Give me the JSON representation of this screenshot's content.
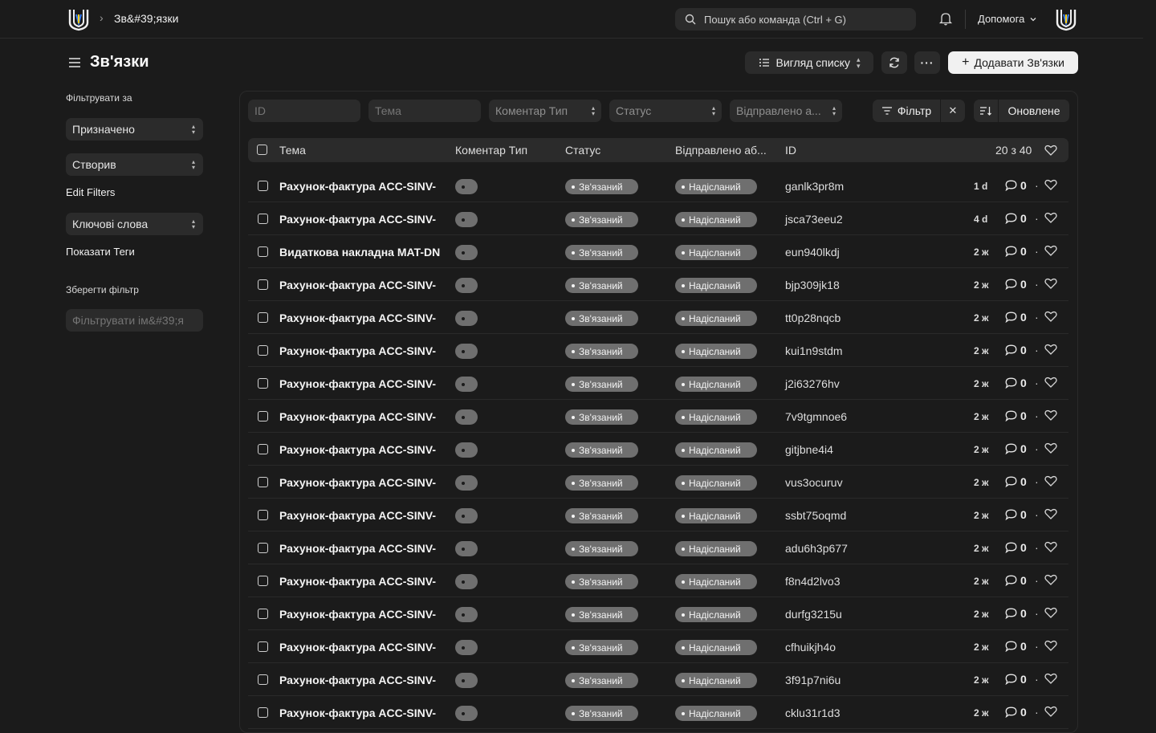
{
  "topbar": {
    "breadcrumb": "Зв&#39;язки",
    "search_placeholder": "Пошук або команда (Ctrl + G)",
    "help_label": "Допомога"
  },
  "header": {
    "title": "Зв'язки",
    "view_label": "Вигляд списку",
    "add_label": "Додавати Зв'язки"
  },
  "sidebar": {
    "filter_by_label": "Фільтрувати за",
    "assigned_label": "Призначено",
    "created_label": "Створив",
    "edit_filters_label": "Edit Filters",
    "keywords_label": "Ключові слова",
    "show_tags_label": "Показати Теги",
    "save_filter_label": "Зберегти фільтр",
    "filter_name_placeholder": "Фільтрувати ім&#39;я"
  },
  "filters": {
    "id_placeholder": "ID",
    "subject_placeholder": "Тема",
    "comment_type_label": "Коментар Тип",
    "status_label": "Статус",
    "sent_label": "Відправлено а...",
    "filter_button": "Фільтр",
    "sort_field": "Оновлене"
  },
  "table": {
    "columns": {
      "subject": "Тема",
      "comment_type": "Коментар Тип",
      "status": "Статус",
      "sent_or_received": "Відправлено аб...",
      "id": "ID"
    },
    "count_label": "20 з 40",
    "rows": [
      {
        "subject": "Рахунок-фактура ACC-SINV-",
        "status": "Зв'язаний",
        "sent": "Надісланий",
        "id": "ganlk3pr8m",
        "age": "1 d",
        "comments": "0"
      },
      {
        "subject": "Рахунок-фактура ACC-SINV-",
        "status": "Зв'язаний",
        "sent": "Надісланий",
        "id": "jsca73eeu2",
        "age": "4 d",
        "comments": "0"
      },
      {
        "subject": "Видаткова накладна MAT-DN",
        "status": "Зв'язаний",
        "sent": "Надісланий",
        "id": "eun940lkdj",
        "age": "2 ж",
        "comments": "0"
      },
      {
        "subject": "Рахунок-фактура ACC-SINV-",
        "status": "Зв'язаний",
        "sent": "Надісланий",
        "id": "bjp309jk18",
        "age": "2 ж",
        "comments": "0"
      },
      {
        "subject": "Рахунок-фактура ACC-SINV-",
        "status": "Зв'язаний",
        "sent": "Надісланий",
        "id": "tt0p28nqcb",
        "age": "2 ж",
        "comments": "0"
      },
      {
        "subject": "Рахунок-фактура ACC-SINV-",
        "status": "Зв'язаний",
        "sent": "Надісланий",
        "id": "kui1n9stdm",
        "age": "2 ж",
        "comments": "0"
      },
      {
        "subject": "Рахунок-фактура ACC-SINV-",
        "status": "Зв'язаний",
        "sent": "Надісланий",
        "id": "j2i63276hv",
        "age": "2 ж",
        "comments": "0"
      },
      {
        "subject": "Рахунок-фактура ACC-SINV-",
        "status": "Зв'язаний",
        "sent": "Надісланий",
        "id": "7v9tgmnoe6",
        "age": "2 ж",
        "comments": "0"
      },
      {
        "subject": "Рахунок-фактура ACC-SINV-",
        "status": "Зв'язаний",
        "sent": "Надісланий",
        "id": "gitjbne4i4",
        "age": "2 ж",
        "comments": "0"
      },
      {
        "subject": "Рахунок-фактура ACC-SINV-",
        "status": "Зв'язаний",
        "sent": "Надісланий",
        "id": "vus3ocuruv",
        "age": "2 ж",
        "comments": "0"
      },
      {
        "subject": "Рахунок-фактура ACC-SINV-",
        "status": "Зв'язаний",
        "sent": "Надісланий",
        "id": "ssbt75oqmd",
        "age": "2 ж",
        "comments": "0"
      },
      {
        "subject": "Рахунок-фактура ACC-SINV-",
        "status": "Зв'язаний",
        "sent": "Надісланий",
        "id": "adu6h3p677",
        "age": "2 ж",
        "comments": "0"
      },
      {
        "subject": "Рахунок-фактура ACC-SINV-",
        "status": "Зв'язаний",
        "sent": "Надісланий",
        "id": "f8n4d2lvo3",
        "age": "2 ж",
        "comments": "0"
      },
      {
        "subject": "Рахунок-фактура ACC-SINV-",
        "status": "Зв'язаний",
        "sent": "Надісланий",
        "id": "durfg3215u",
        "age": "2 ж",
        "comments": "0"
      },
      {
        "subject": "Рахунок-фактура ACC-SINV-",
        "status": "Зв'язаний",
        "sent": "Надісланий",
        "id": "cfhuikjh4o",
        "age": "2 ж",
        "comments": "0"
      },
      {
        "subject": "Рахунок-фактура ACC-SINV-",
        "status": "Зв'язаний",
        "sent": "Надісланий",
        "id": "3f91p7ni6u",
        "age": "2 ж",
        "comments": "0"
      },
      {
        "subject": "Рахунок-фактура ACC-SINV-",
        "status": "Зв'язаний",
        "sent": "Надісланий",
        "id": "cklu31r1d3",
        "age": "2 ж",
        "comments": "0"
      }
    ]
  },
  "colors": {
    "background": "#1b1b1b",
    "surface": "#2b2b2b",
    "pill": "#6f6f6f",
    "primary_button": "#f1f1f1"
  }
}
